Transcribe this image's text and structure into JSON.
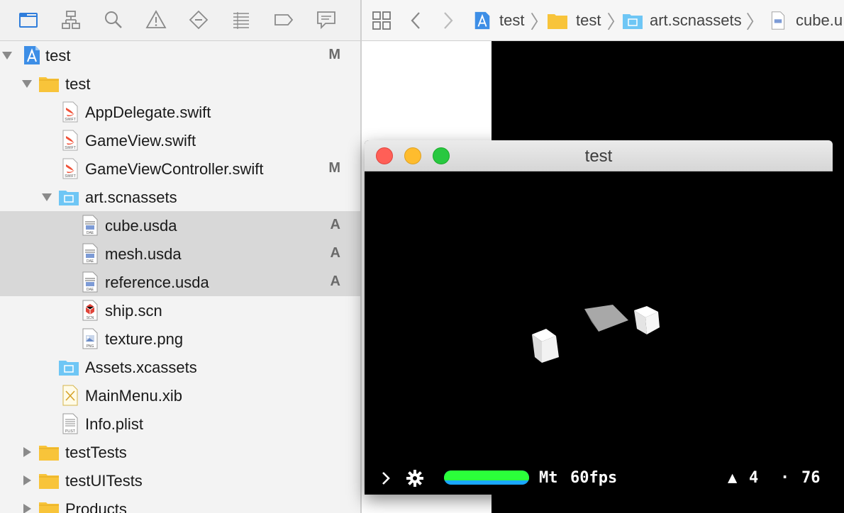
{
  "navigator": {
    "toolbar_icons": [
      "folder-icon",
      "hierarchy-icon",
      "search-icon",
      "warning-icon",
      "diamond-icon",
      "list-icon",
      "tag-icon",
      "comment-icon"
    ],
    "items": [
      {
        "name": "test",
        "type": "project",
        "badge": "M",
        "expanded": true
      },
      {
        "name": "test",
        "type": "folder",
        "badge": "",
        "expanded": true
      },
      {
        "name": "AppDelegate.swift",
        "type": "swift",
        "badge": ""
      },
      {
        "name": "GameView.swift",
        "type": "swift",
        "badge": ""
      },
      {
        "name": "GameViewController.swift",
        "type": "swift",
        "badge": "M"
      },
      {
        "name": "art.scnassets",
        "type": "blue-folder",
        "badge": "",
        "expanded": true
      },
      {
        "name": "cube.usda",
        "type": "dae",
        "badge": "A",
        "selected": true
      },
      {
        "name": "mesh.usda",
        "type": "dae",
        "badge": "A",
        "selected": true
      },
      {
        "name": "reference.usda",
        "type": "dae",
        "badge": "A",
        "selected": true
      },
      {
        "name": "ship.scn",
        "type": "scn",
        "badge": ""
      },
      {
        "name": "texture.png",
        "type": "png",
        "badge": ""
      },
      {
        "name": "Assets.xcassets",
        "type": "blue-folder",
        "badge": ""
      },
      {
        "name": "MainMenu.xib",
        "type": "xib",
        "badge": ""
      },
      {
        "name": "Info.plist",
        "type": "plist",
        "badge": ""
      },
      {
        "name": "testTests",
        "type": "folder",
        "badge": "",
        "expanded": false
      },
      {
        "name": "testUITests",
        "type": "folder",
        "badge": "",
        "expanded": false
      },
      {
        "name": "Products",
        "type": "folder",
        "badge": "",
        "expanded": false
      }
    ]
  },
  "icon_captions": {
    "swift": "SWIFT",
    "dae": "DAE",
    "scn": "SCN",
    "png": "PNG",
    "plist": "PLIST"
  },
  "jumpbar": {
    "crumbs": [
      "test",
      "test",
      "art.scnassets",
      "cube.u"
    ]
  },
  "game_window": {
    "title": "test",
    "stats": {
      "renderer": "Mt",
      "fps": "60fps",
      "triangles": "4",
      "points": "76",
      "triangle_glyph": "▲",
      "point_glyph": "·"
    }
  },
  "colors": {
    "close": "#ff5f57",
    "minimize": "#febc2e",
    "zoom": "#28c840",
    "fps_bar_green": "#2bff3a",
    "fps_bar_blue": "#1aa7ff",
    "folder_yellow": "#f8c43a",
    "folder_blue": "#6ec6f5"
  }
}
